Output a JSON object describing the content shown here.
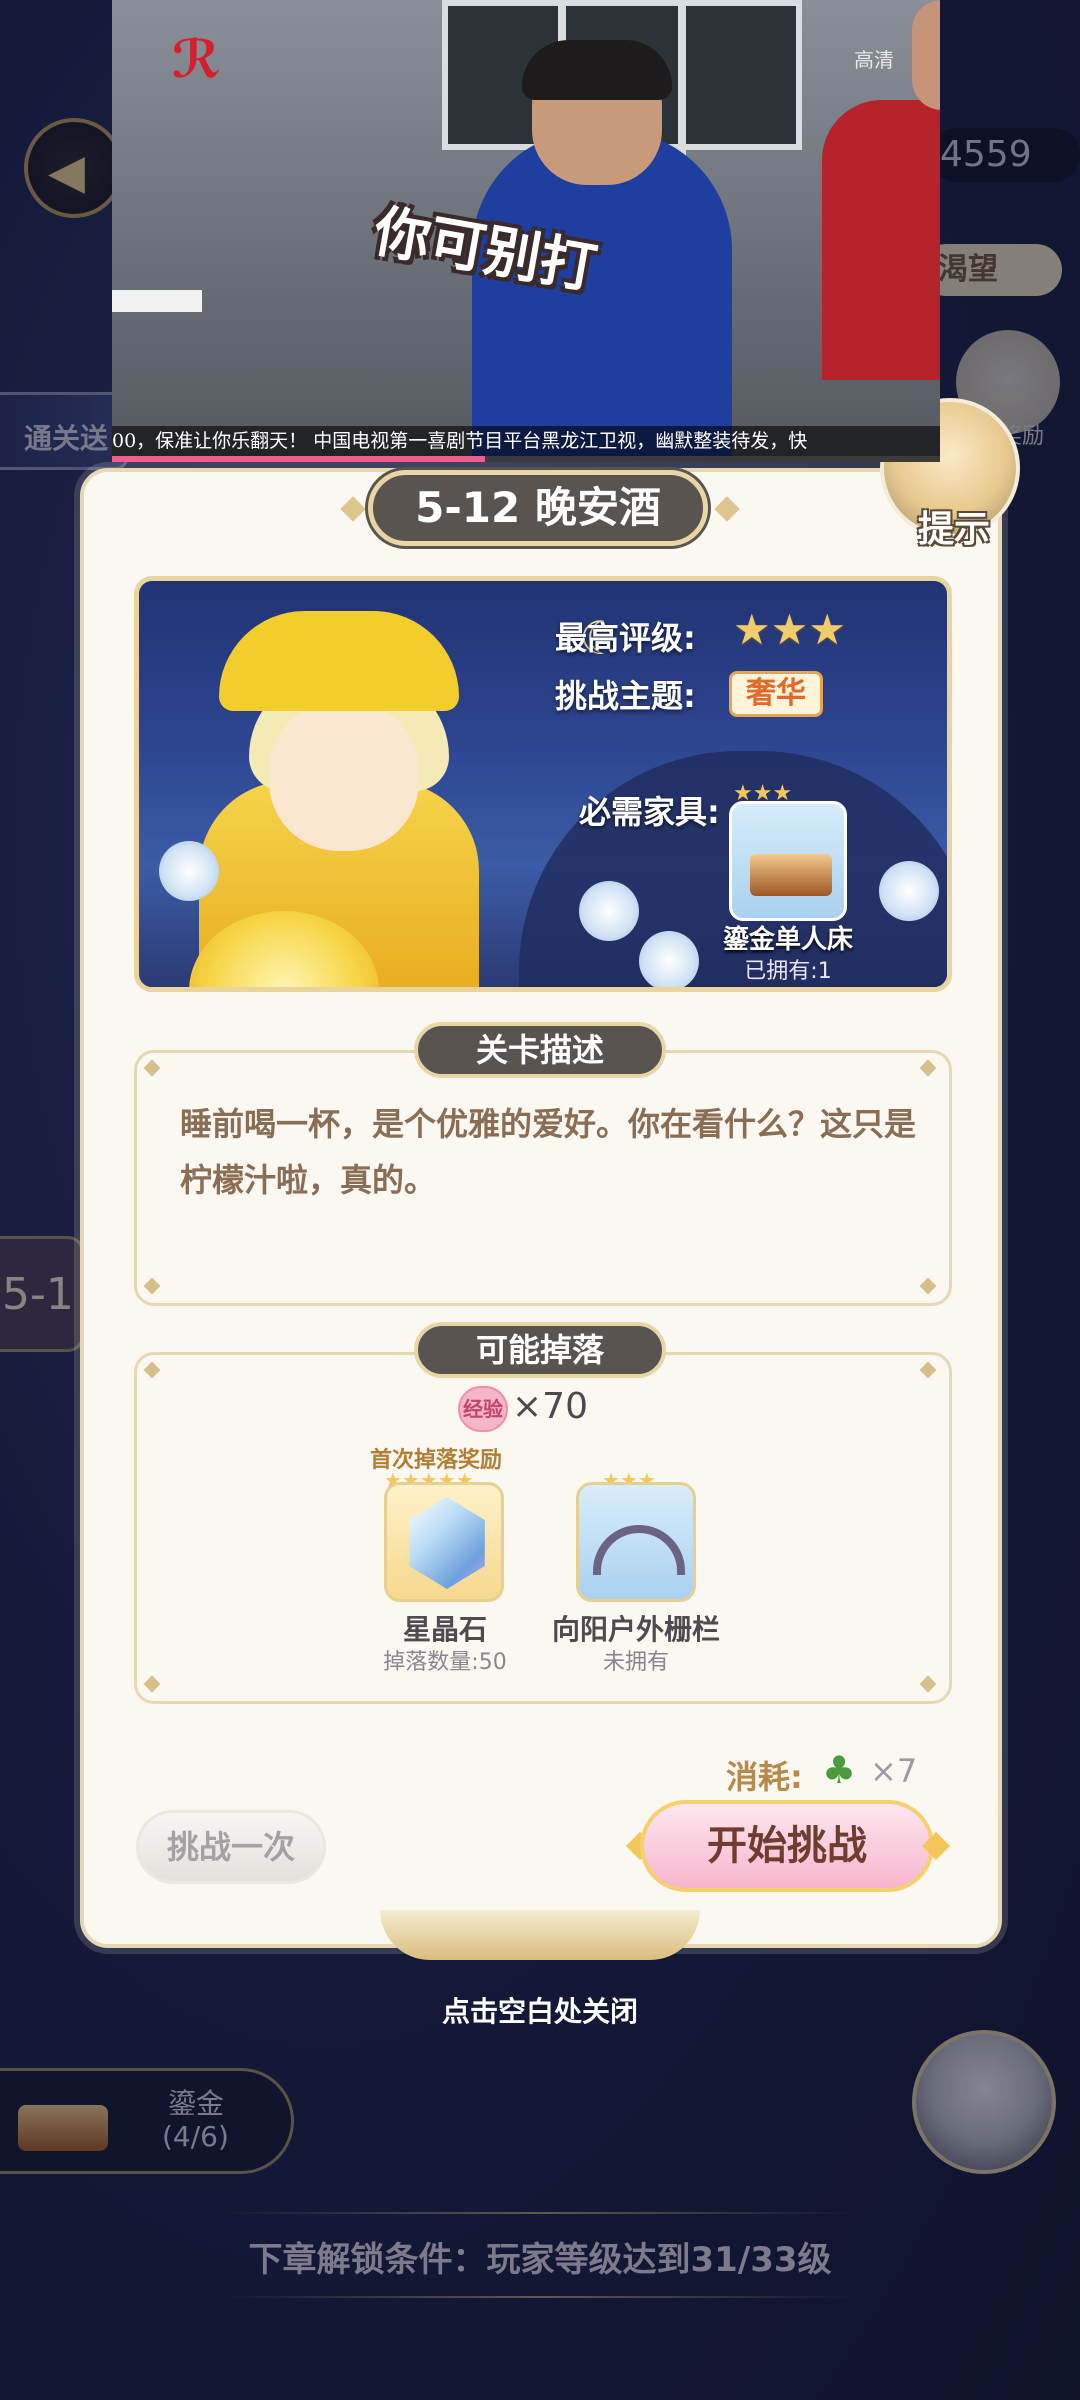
{
  "background": {
    "coins": "4559",
    "wish_label": "渴望",
    "reward_label": "奖励",
    "hint_label": "提示",
    "left_tab_label": "通关送",
    "left_book_label": "5-1",
    "set_name": "鎏金",
    "set_count": "(4/6)",
    "close_hint": "点击空白处关闭",
    "unlock_condition": "下章解锁条件：玩家等级达到31/33级"
  },
  "video": {
    "caption": "你可别打",
    "quality": "高清",
    "ticker": "00，保准让你乐翻天！ 中国电视第一喜剧节目平台黑龙江卫视，幽默整装待发，快",
    "progress": 0.45
  },
  "dialog": {
    "title": "5-12 晚安酒",
    "best_rating_label": "最高评级:",
    "best_rating_stars": 3,
    "theme_label": "挑战主题:",
    "theme_value": "奢华",
    "required_furniture_label": "必需家具:",
    "furniture_name": "鎏金单人床",
    "furniture_owned": "已拥有:1",
    "furniture_stars": 3,
    "description_title": "关卡描述",
    "description": "睡前喝一杯，是个优雅的爱好。你在看什么？这只是柠檬汁啦，真的。",
    "drops_title": "可能掉落",
    "exp_badge": "经验",
    "exp_value": "×70",
    "first_drop_label": "首次掉落奖励",
    "drops": [
      {
        "name": "星晶石",
        "sub": "掉落数量:50",
        "stars": 5
      },
      {
        "name": "向阳户外栅栏",
        "sub": "未拥有",
        "stars": 3
      }
    ],
    "cost_label": "消耗:",
    "cost_value": "×7",
    "challenge_once": "挑战一次",
    "start_challenge": "开始挑战"
  },
  "colors": {
    "accent_gold": "#e9d6a6",
    "plate_dark": "#5a5451",
    "start_pink": "#f7b6cd",
    "desc_brown": "#8a6d52"
  }
}
